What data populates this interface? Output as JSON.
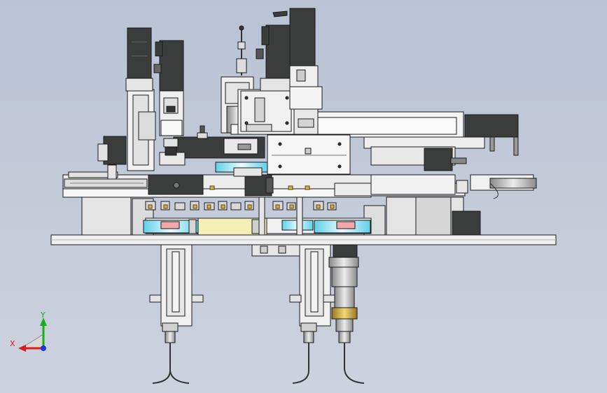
{
  "colors": {
    "background_top": "#b9c3d4",
    "background_bottom": "#ccd2de",
    "part_light": "#e8e8e8",
    "part_white": "#f4f4f4",
    "motor_dark": "#3b3d3c",
    "edge": "#1a1a1a",
    "cyan_part": "#7fe0f0",
    "pink_part": "#f0a8a8",
    "yellow_part": "#f4f0b8",
    "gold_part": "#d8b040",
    "axis_x": "#e01818",
    "axis_y": "#18b018",
    "axis_z": "#1838e0"
  },
  "triad": {
    "x_label": "X",
    "y_label": "Y"
  }
}
